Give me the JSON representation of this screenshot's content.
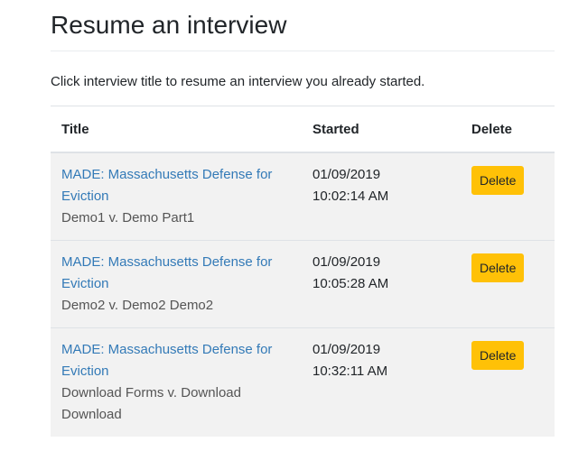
{
  "page": {
    "title": "Resume an interview",
    "instructions": "Click interview title to resume an interview you already started."
  },
  "table": {
    "headers": {
      "title": "Title",
      "started": "Started",
      "delete": "Delete"
    },
    "rows": [
      {
        "title": "MADE: Massachusetts Defense for Eviction",
        "subtitle": "Demo1 v. Demo Part1",
        "started_date": "01/09/2019",
        "started_time": "10:02:14 AM",
        "delete_label": "Delete"
      },
      {
        "title": "MADE: Massachusetts Defense for Eviction",
        "subtitle": "Demo2 v. Demo2 Demo2",
        "started_date": "01/09/2019",
        "started_time": "10:05:28 AM",
        "delete_label": "Delete"
      },
      {
        "title": "MADE: Massachusetts Defense for Eviction",
        "subtitle": "Download Forms v. Download Download",
        "started_date": "01/09/2019",
        "started_time": "10:32:11 AM",
        "delete_label": "Delete"
      }
    ]
  },
  "colors": {
    "link": "#337ab7",
    "delete_button": "#ffc107",
    "row_background": "#f2f2f2"
  }
}
